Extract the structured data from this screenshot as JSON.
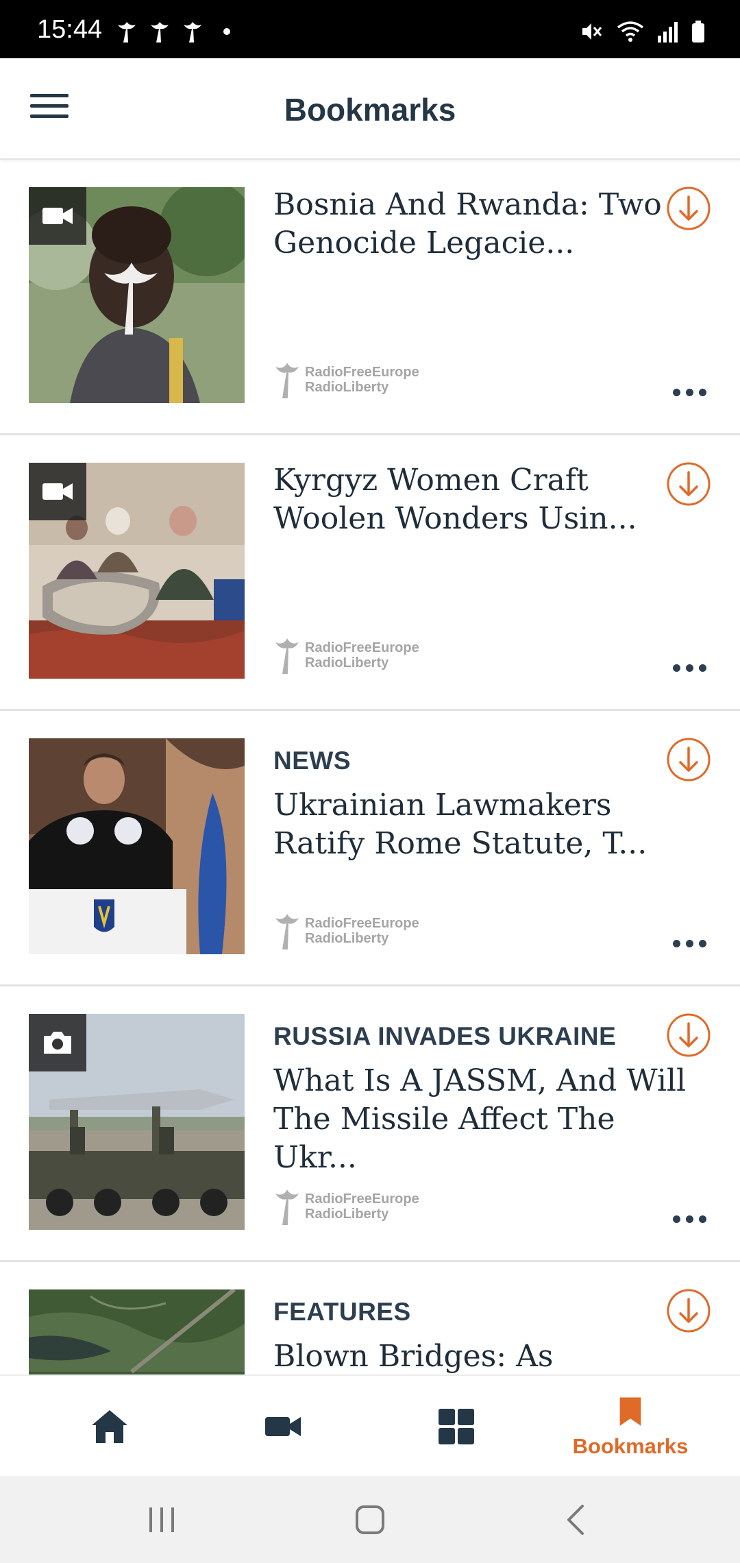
{
  "status_bar": {
    "time": "15:44",
    "left_icons": [
      "rferl-notification-icon",
      "rferl-notification-icon",
      "rferl-notification-icon"
    ],
    "right_icons": [
      "mute-icon",
      "wifi-icon",
      "signal-icon",
      "battery-icon"
    ]
  },
  "app_bar": {
    "title": "Bookmarks",
    "menu_icon": "hamburger-menu-icon"
  },
  "items": [
    {
      "category": "",
      "title": "Bosnia And Rwanda: Two Genocide Legacie...",
      "media_type": "video",
      "source_line1": "RadioFreeEurope",
      "source_line2": "RadioLiberty"
    },
    {
      "category": "",
      "title": "Kyrgyz Women Craft Woolen Wonders Usin...",
      "media_type": "video",
      "source_line1": "RadioFreeEurope",
      "source_line2": "RadioLiberty"
    },
    {
      "category": "NEWS",
      "title": "Ukrainian Lawmakers Ratify Rome Statute, T...",
      "media_type": "",
      "source_line1": "RadioFreeEurope",
      "source_line2": "RadioLiberty"
    },
    {
      "category": "RUSSIA INVADES UKRAINE",
      "title": "What Is A JASSM, And Will The Missile Affect The Ukr...",
      "media_type": "photo",
      "source_line1": "RadioFreeEurope",
      "source_line2": "RadioLiberty"
    },
    {
      "category": "FEATURES",
      "title": "Blown Bridges: As",
      "media_type": "",
      "source_line1": "",
      "source_line2": ""
    }
  ],
  "bottom_nav": {
    "items": [
      {
        "icon": "home-icon",
        "label": ""
      },
      {
        "icon": "video-camera-icon",
        "label": ""
      },
      {
        "icon": "grid-icon",
        "label": ""
      },
      {
        "icon": "bookmark-icon",
        "label": "Bookmarks"
      }
    ],
    "active": "Bookmarks"
  },
  "colors": {
    "accent": "#e06a28",
    "text_dark": "#243746",
    "divider": "#e3e3e3"
  }
}
